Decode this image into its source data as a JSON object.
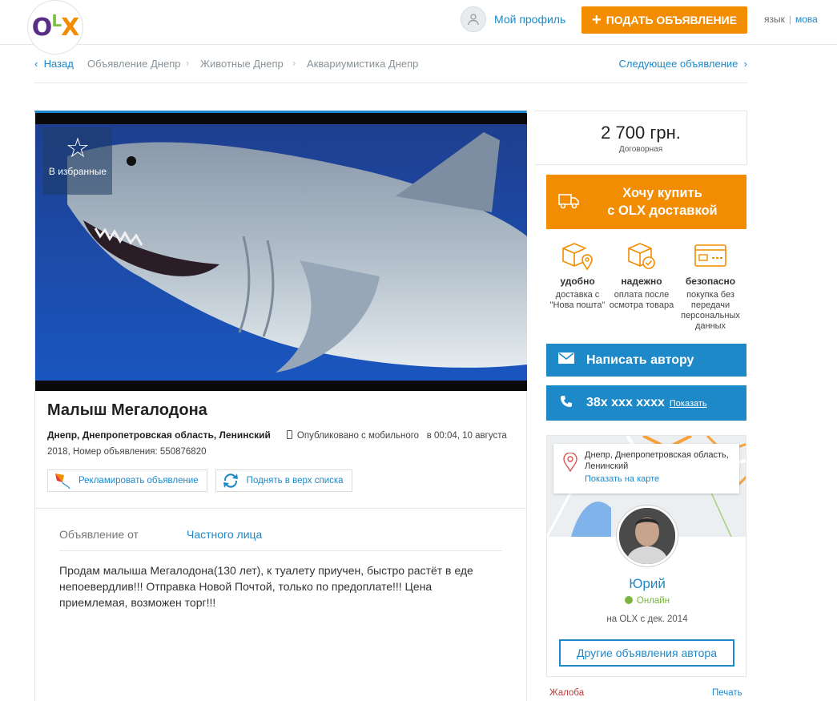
{
  "header": {
    "logo": "OLX",
    "profile_label": "Мой профиль",
    "post_button": "ПОДАТЬ ОБЪЯВЛЕНИЕ",
    "lang_current": "язык",
    "lang_alt": "мова"
  },
  "breadcrumb": {
    "back": "Назад",
    "items": [
      "Объявление Днепр",
      "Животные Днепр",
      "Аквариумистика Днепр"
    ],
    "next": "Следующее объявление"
  },
  "listing": {
    "favorite_label": "В избранные",
    "title": "Малыш Мегалодона",
    "location": "Днепр, Днепропетровская область, Ленинский",
    "published_mobile": "Опубликовано с мобильного",
    "published_rest": "в 00:04, 10 августа 2018, Номер объявления: 550876820",
    "promote_label": "Рекламировать объявление",
    "raise_label": "Поднять в верх списка",
    "from_label": "Объявление от",
    "from_value": "Частного лица",
    "description": "Продам малыша Мегалодона(130 лет), к туалету приучен, быстро растёт в еде непоевердлив!!! Отправка Новой Почтой, только по предоплате!!! Цена приемлемая, возможен торг!!!"
  },
  "price": {
    "value": "2 700 грн.",
    "note": "Договорная"
  },
  "delivery": {
    "button_line1": "Хочу купить",
    "button_line2": "с OLX доставкой",
    "features": [
      {
        "title": "удобно",
        "text": "доставка с \"Нова пошта\"",
        "icon": "box-location-icon"
      },
      {
        "title": "надежно",
        "text": "оплата после осмотра товара",
        "icon": "box-check-icon"
      },
      {
        "title": "безопасно",
        "text": "покупка без передачи персональных данных",
        "icon": "card-icon"
      }
    ]
  },
  "contact": {
    "message_button": "Написать автору",
    "phone": "38x xxx xxxx",
    "show_phone": "Показать"
  },
  "seller": {
    "address": "Днепр, Днепропетровская область, Ленинский",
    "map_link": "Показать на карте",
    "name": "Юрий",
    "status": "Онлайн",
    "since": "на OLX с дек. 2014",
    "other_ads": "Другие объявления автора"
  },
  "footer": {
    "complain": "Жалоба",
    "print": "Печать"
  },
  "colors": {
    "accent_orange": "#f28c00",
    "accent_blue": "#1e89c9",
    "online_green": "#7cb342"
  }
}
